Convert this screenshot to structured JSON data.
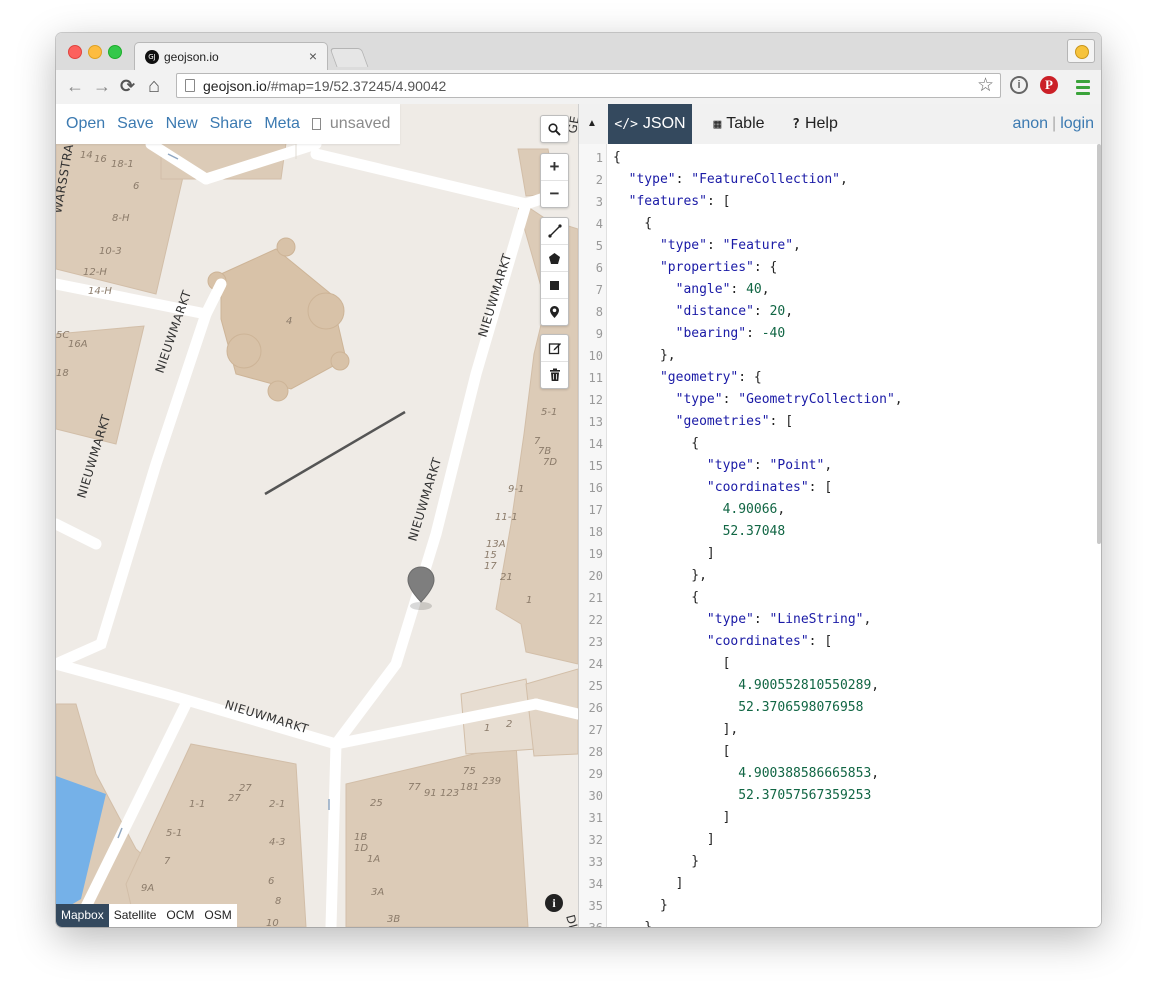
{
  "browser": {
    "tab_title": "geojson.io",
    "tab_favicon": "GJ",
    "tab_close": "×",
    "url_host": "geojson.io",
    "url_rest": "/#map=19/52.37245/4.90042",
    "nav": {
      "back": "←",
      "forward": "→",
      "reload": "⟳",
      "home": "⌂"
    },
    "star_glyph": "☆",
    "extensions": {
      "onepassword": "i",
      "pinterest": "P"
    }
  },
  "app_menu": {
    "open": "Open",
    "save": "Save",
    "new": "New",
    "share": "Share",
    "meta": "Meta",
    "status": "unsaved"
  },
  "map_controls": {
    "search": "search-icon",
    "zoom_in": "+",
    "zoom_out": "−",
    "tools": [
      "line-icon",
      "polygon-icon",
      "rectangle-icon",
      "marker-icon"
    ],
    "edit": [
      "edit-icon",
      "trash-icon"
    ],
    "info": "i"
  },
  "map_labels": {
    "streets": [
      "NIEUWMARKT",
      "NIEUWMARKT",
      "NIEUWMARKT",
      "NIEUWMARKT",
      "NIEUWMARKT",
      "WARSSTRA",
      "GE",
      "DI"
    ],
    "numbers": [
      "14",
      "16",
      "18-1",
      "6",
      "8-H",
      "10-3",
      "12-H",
      "14-H",
      "4",
      "5C",
      "16A",
      "18",
      "5-1",
      "7",
      "7B",
      "7D",
      "9-1",
      "11-1",
      "13A",
      "15",
      "17",
      "21",
      "1",
      "1",
      "2",
      "27",
      "27",
      "1-1",
      "2-1",
      "4-3",
      "5-1",
      "7",
      "6",
      "9A",
      "8",
      "10",
      "77",
      "91",
      "123",
      "181",
      "75",
      "239",
      "25",
      "1B",
      "1D",
      "1A",
      "3A",
      "3B"
    ]
  },
  "layers": [
    "Mapbox",
    "Satellite",
    "OCM",
    "OSM"
  ],
  "active_layer": "Mapbox",
  "pane": {
    "collapse": "▲",
    "tabs": [
      {
        "icon": "</>",
        "label": "JSON",
        "active": true
      },
      {
        "icon": "▦",
        "label": "Table",
        "active": false
      },
      {
        "icon": "?",
        "label": "Help",
        "active": false
      }
    ],
    "account": {
      "anon": "anon",
      "sep": "|",
      "login": "login"
    }
  },
  "json_lines": [
    "{",
    "  \"type\": \"FeatureCollection\",",
    "  \"features\": [",
    "    {",
    "      \"type\": \"Feature\",",
    "      \"properties\": {",
    "        \"angle\": 40,",
    "        \"distance\": 20,",
    "        \"bearing\": -40",
    "      },",
    "      \"geometry\": {",
    "        \"type\": \"GeometryCollection\",",
    "        \"geometries\": [",
    "          {",
    "            \"type\": \"Point\",",
    "            \"coordinates\": [",
    "              4.90066,",
    "              52.37048",
    "            ]",
    "          },",
    "          {",
    "            \"type\": \"LineString\",",
    "            \"coordinates\": [",
    "              [",
    "                4.900552810550289,",
    "                52.3706598076958",
    "              ],",
    "              [",
    "                4.900388586665853,",
    "                52.37057567359253",
    "              ]",
    "            ]",
    "          }",
    "        ]",
    "      }",
    "    }"
  ],
  "colors": {
    "link": "#3c7ab1",
    "active_tab": "#34495e",
    "json_key": "#1a1aa6",
    "json_number": "#116644",
    "map_bg": "#efebe6",
    "building": "#dccbb7",
    "water": "#75b1e8"
  }
}
